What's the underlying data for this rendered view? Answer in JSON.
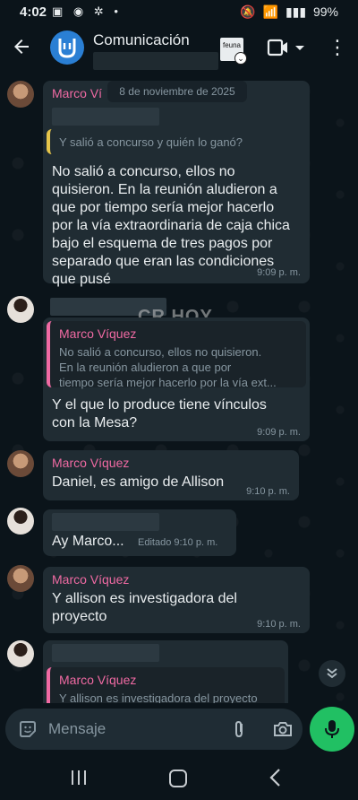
{
  "status_bar": {
    "time": "4:02",
    "left_icons": "▣ ◉ ✲ •",
    "right_icons": [
      "🔕",
      "📶",
      "▮▮▮"
    ],
    "battery": "99%"
  },
  "header": {
    "title": "Comunicación",
    "thumb_text": "feuna"
  },
  "date_chip": "8 de noviembre de 2025",
  "watermark": "CR HOY",
  "messages": [
    {
      "sender": "Marco Ví",
      "quote_text": "Y salió a concurso y quién lo ganó?",
      "lines": [
        "No salió a concurso, ellos no",
        "quisieron. En la reunión aludieron a",
        "que por tiempo sería mejor hacerlo",
        "por la vía extraordinaria de caja chica",
        "bajo el esquema de tres pagos por",
        "separado que eran las condiciones",
        "que pusé"
      ],
      "time": "9:09 p. m."
    },
    {
      "quote_name": "Marco Víquez",
      "quote_lines": [
        "No salió a concurso, ellos no quisieron.",
        "En la reunión aludieron a que por",
        "tiempo sería mejor hacerlo por la vía ext..."
      ],
      "lines": [
        "Y el que lo produce tiene vínculos",
        "con la Mesa?"
      ],
      "time": "9:09 p. m."
    },
    {
      "sender": "Marco Víquez",
      "lines": [
        "Daniel, es amigo de Allison"
      ],
      "time": "9:10 p. m."
    },
    {
      "lines": [
        "Ay Marco..."
      ],
      "edited": "Editado",
      "time": "9:10 p. m."
    },
    {
      "sender": "Marco Víquez",
      "lines": [
        "Y allison es investigadora del",
        "proyecto"
      ],
      "time": "9:10 p. m."
    },
    {
      "quote_name": "Marco Víquez",
      "quote_lines": [
        "Y allison es investigadora del proyecto"
      ]
    }
  ],
  "input": {
    "placeholder": "Mensaje"
  }
}
